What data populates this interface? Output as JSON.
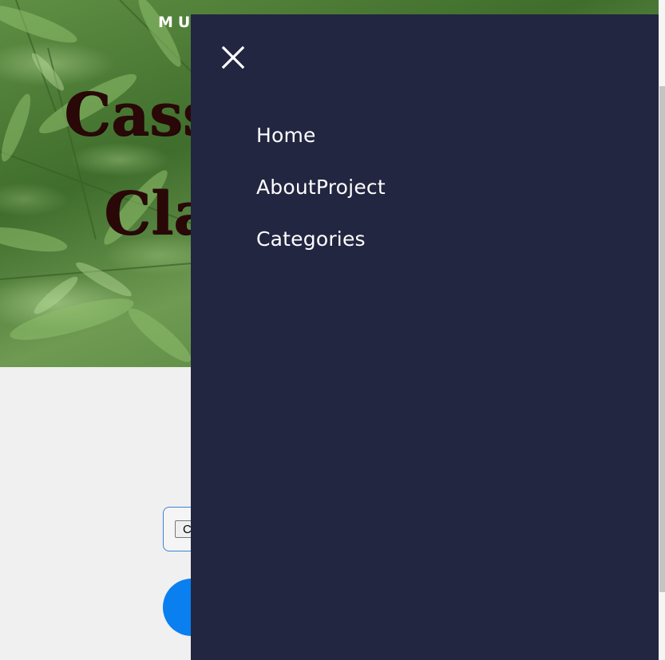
{
  "header": {
    "brand": "MU"
  },
  "hero": {
    "title_line1": "Cassa",
    "title_line2": "Clas"
  },
  "upload": {
    "file_button_label": "C"
  },
  "side_menu": {
    "items": [
      {
        "label": "Home"
      },
      {
        "label": "AboutProject"
      },
      {
        "label": "Categories"
      }
    ]
  },
  "colors": {
    "menu_bg": "#222640",
    "accent_blue": "#0a7ff0",
    "title_color": "#2a0808"
  }
}
